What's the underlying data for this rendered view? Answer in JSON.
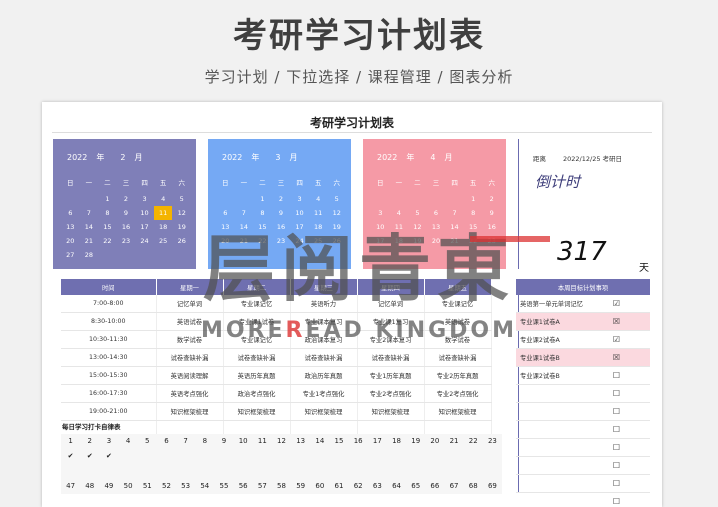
{
  "header": {
    "title": "考研学习计划表",
    "subtitle": "学习计划 / 下拉选择 / 课程管理 / 图表分析"
  },
  "sheet": {
    "title": "考研学习计划表"
  },
  "calendars": [
    {
      "year": "2022",
      "year_unit": "年",
      "month": "2",
      "month_unit": "月",
      "weekdays": [
        "日",
        "一",
        "二",
        "三",
        "四",
        "五",
        "六"
      ],
      "days": [
        "",
        "",
        "1",
        "2",
        "3",
        "4",
        "5",
        "6",
        "7",
        "8",
        "9",
        "10",
        "11",
        "12",
        "13",
        "14",
        "15",
        "16",
        "17",
        "18",
        "19",
        "20",
        "21",
        "22",
        "23",
        "24",
        "25",
        "26",
        "27",
        "28"
      ],
      "today": "11",
      "color": "#7f7fb8"
    },
    {
      "year": "2022",
      "year_unit": "年",
      "month": "3",
      "month_unit": "月",
      "weekdays": [
        "日",
        "一",
        "二",
        "三",
        "四",
        "五",
        "六"
      ],
      "days": [
        "",
        "",
        "1",
        "2",
        "3",
        "4",
        "5",
        "6",
        "7",
        "8",
        "9",
        "10",
        "11",
        "12",
        "13",
        "14",
        "15",
        "16",
        "17",
        "18",
        "19",
        "20",
        "21",
        "22",
        "23",
        "24",
        "25",
        "26"
      ],
      "today": "",
      "color": "#75a9f4"
    },
    {
      "year": "2022",
      "year_unit": "年",
      "month": "4",
      "month_unit": "月",
      "weekdays": [
        "日",
        "一",
        "二",
        "三",
        "四",
        "五",
        "六"
      ],
      "days": [
        "",
        "",
        "",
        "",
        "",
        "1",
        "2",
        "3",
        "4",
        "5",
        "6",
        "7",
        "8",
        "9",
        "10",
        "11",
        "12",
        "13",
        "14",
        "15",
        "16",
        "17",
        "18",
        "19",
        "20",
        "21",
        "22",
        "23"
      ],
      "today": "",
      "color": "#f59aa6"
    }
  ],
  "countdown": {
    "label": "距离",
    "target": "2022/12/25 考研日",
    "script": "倒计时",
    "number": "317",
    "unit": "天"
  },
  "schedule": {
    "headers": [
      "时间",
      "星期一",
      "星期二",
      "星期三",
      "星期四",
      "星期五"
    ],
    "rows": [
      [
        "7:00-8:00",
        "记忆单词",
        "专业课记忆",
        "英语听力",
        "记忆单词",
        "专业课记忆"
      ],
      [
        "8:30-10:00",
        "英语试卷",
        "专业课1试卷",
        "专业课本复习",
        "专业课1复习",
        "英语试卷"
      ],
      [
        "10:30-11:30",
        "数学试卷",
        "专业课记忆",
        "政治课本复习",
        "专业2课本复习",
        "数学试卷"
      ],
      [
        "13:00-14:30",
        "试卷查缺补漏",
        "试卷查缺补漏",
        "试卷查缺补漏",
        "试卷查缺补漏",
        "试卷查缺补漏"
      ],
      [
        "15:00-15:30",
        "英语阅读理解",
        "英语历年真题",
        "政治历年真题",
        "专业1历年真题",
        "专业2历年真题"
      ],
      [
        "16:00-17:30",
        "英语考点强化",
        "政治考点强化",
        "专业1考点强化",
        "专业2考点强化",
        "专业2考点强化"
      ],
      [
        "19:00-21:00",
        "知识框架梳理",
        "知识框架梳理",
        "知识框架梳理",
        "知识框架梳理",
        "知识框架梳理"
      ],
      [
        "",
        "",
        "",
        "",
        "",
        ""
      ]
    ]
  },
  "goals": {
    "header": "本周目标计划事项",
    "items": [
      {
        "text": "英语第一单元单词记忆",
        "mark": "☑",
        "hl": false
      },
      {
        "text": "专业课1试卷A",
        "mark": "☒",
        "hl": true
      },
      {
        "text": "专业课2试卷A",
        "mark": "☑",
        "hl": false
      },
      {
        "text": "专业课1试卷B",
        "mark": "☒",
        "hl": true
      },
      {
        "text": "专业课2试卷B",
        "mark": "☐",
        "hl": false
      },
      {
        "text": "",
        "mark": "☐",
        "hl": false
      },
      {
        "text": "",
        "mark": "☐",
        "hl": false
      },
      {
        "text": "",
        "mark": "☐",
        "hl": false
      },
      {
        "text": "",
        "mark": "☐",
        "hl": false
      },
      {
        "text": "",
        "mark": "☐",
        "hl": false
      },
      {
        "text": "",
        "mark": "☐",
        "hl": false
      },
      {
        "text": "",
        "mark": "☐",
        "hl": false
      },
      {
        "text": "",
        "mark": "☐",
        "hl": false
      }
    ]
  },
  "checkin": {
    "title": "每日学习打卡自律表",
    "cells": [
      "1",
      "2",
      "3",
      "4",
      "5",
      "6",
      "7",
      "8",
      "9",
      "10",
      "11",
      "12",
      "13",
      "14",
      "15",
      "16",
      "17",
      "18",
      "19",
      "20",
      "21",
      "22",
      "23",
      "✔",
      "✔",
      "✔",
      "",
      "",
      "",
      "",
      "",
      "",
      "",
      "",
      "",
      "",
      "",
      "",
      "",
      "",
      "",
      "",
      "",
      "",
      "",
      "",
      "",
      "",
      "",
      "",
      "",
      "",
      "",
      "",
      "",
      "",
      "",
      "",
      "",
      "",
      "",
      "",
      "",
      "",
      "",
      "",
      "",
      "",
      "",
      "47",
      "48",
      "49",
      "50",
      "51",
      "52",
      "53",
      "54",
      "55",
      "56",
      "57",
      "58",
      "59",
      "60",
      "61",
      "62",
      "63",
      "64",
      "65",
      "66",
      "67",
      "68",
      "69"
    ]
  },
  "watermark": {
    "cn": "层阅青東",
    "en_prefix": "MORE",
    "en_mid": "R",
    "en_suffix": "EAD KINGDOM"
  }
}
